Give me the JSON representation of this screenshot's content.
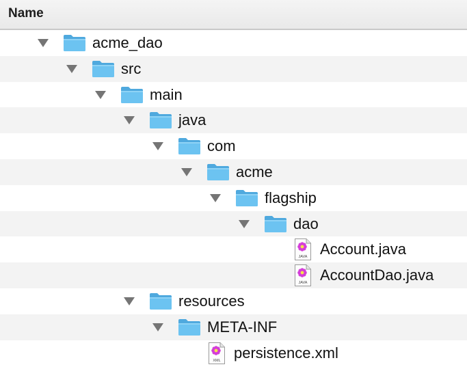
{
  "header": {
    "name_label": "Name"
  },
  "tree": [
    {
      "label": "acme_dao",
      "type": "folder",
      "depth": 0,
      "expanded": true,
      "icon": "folder-icon"
    },
    {
      "label": "src",
      "type": "folder",
      "depth": 1,
      "expanded": true,
      "icon": "folder-icon"
    },
    {
      "label": "main",
      "type": "folder",
      "depth": 2,
      "expanded": true,
      "icon": "folder-icon"
    },
    {
      "label": "java",
      "type": "folder",
      "depth": 3,
      "expanded": true,
      "icon": "folder-icon"
    },
    {
      "label": "com",
      "type": "folder",
      "depth": 4,
      "expanded": true,
      "icon": "folder-icon"
    },
    {
      "label": "acme",
      "type": "folder",
      "depth": 5,
      "expanded": true,
      "icon": "folder-icon"
    },
    {
      "label": "flagship",
      "type": "folder",
      "depth": 6,
      "expanded": true,
      "icon": "folder-icon"
    },
    {
      "label": "dao",
      "type": "folder",
      "depth": 7,
      "expanded": true,
      "icon": "folder-icon"
    },
    {
      "label": "Account.java",
      "type": "file",
      "depth": 8,
      "icon": "java-file-icon",
      "icon_text": "JAVA"
    },
    {
      "label": "AccountDao.java",
      "type": "file",
      "depth": 8,
      "icon": "java-file-icon",
      "icon_text": "JAVA"
    },
    {
      "label": "resources",
      "type": "folder",
      "depth": 3,
      "expanded": true,
      "icon": "folder-icon"
    },
    {
      "label": "META-INF",
      "type": "folder",
      "depth": 4,
      "expanded": true,
      "icon": "folder-icon"
    },
    {
      "label": "persistence.xml",
      "type": "file",
      "depth": 5,
      "icon": "xml-file-icon",
      "icon_text": "XML"
    }
  ],
  "colors": {
    "folder_body": "#6cc3f1",
    "folder_tab": "#4fa9de",
    "disclosure_triangle": "#757575",
    "row_alt": "#f3f3f3",
    "file_flower": "#d43ed8"
  }
}
